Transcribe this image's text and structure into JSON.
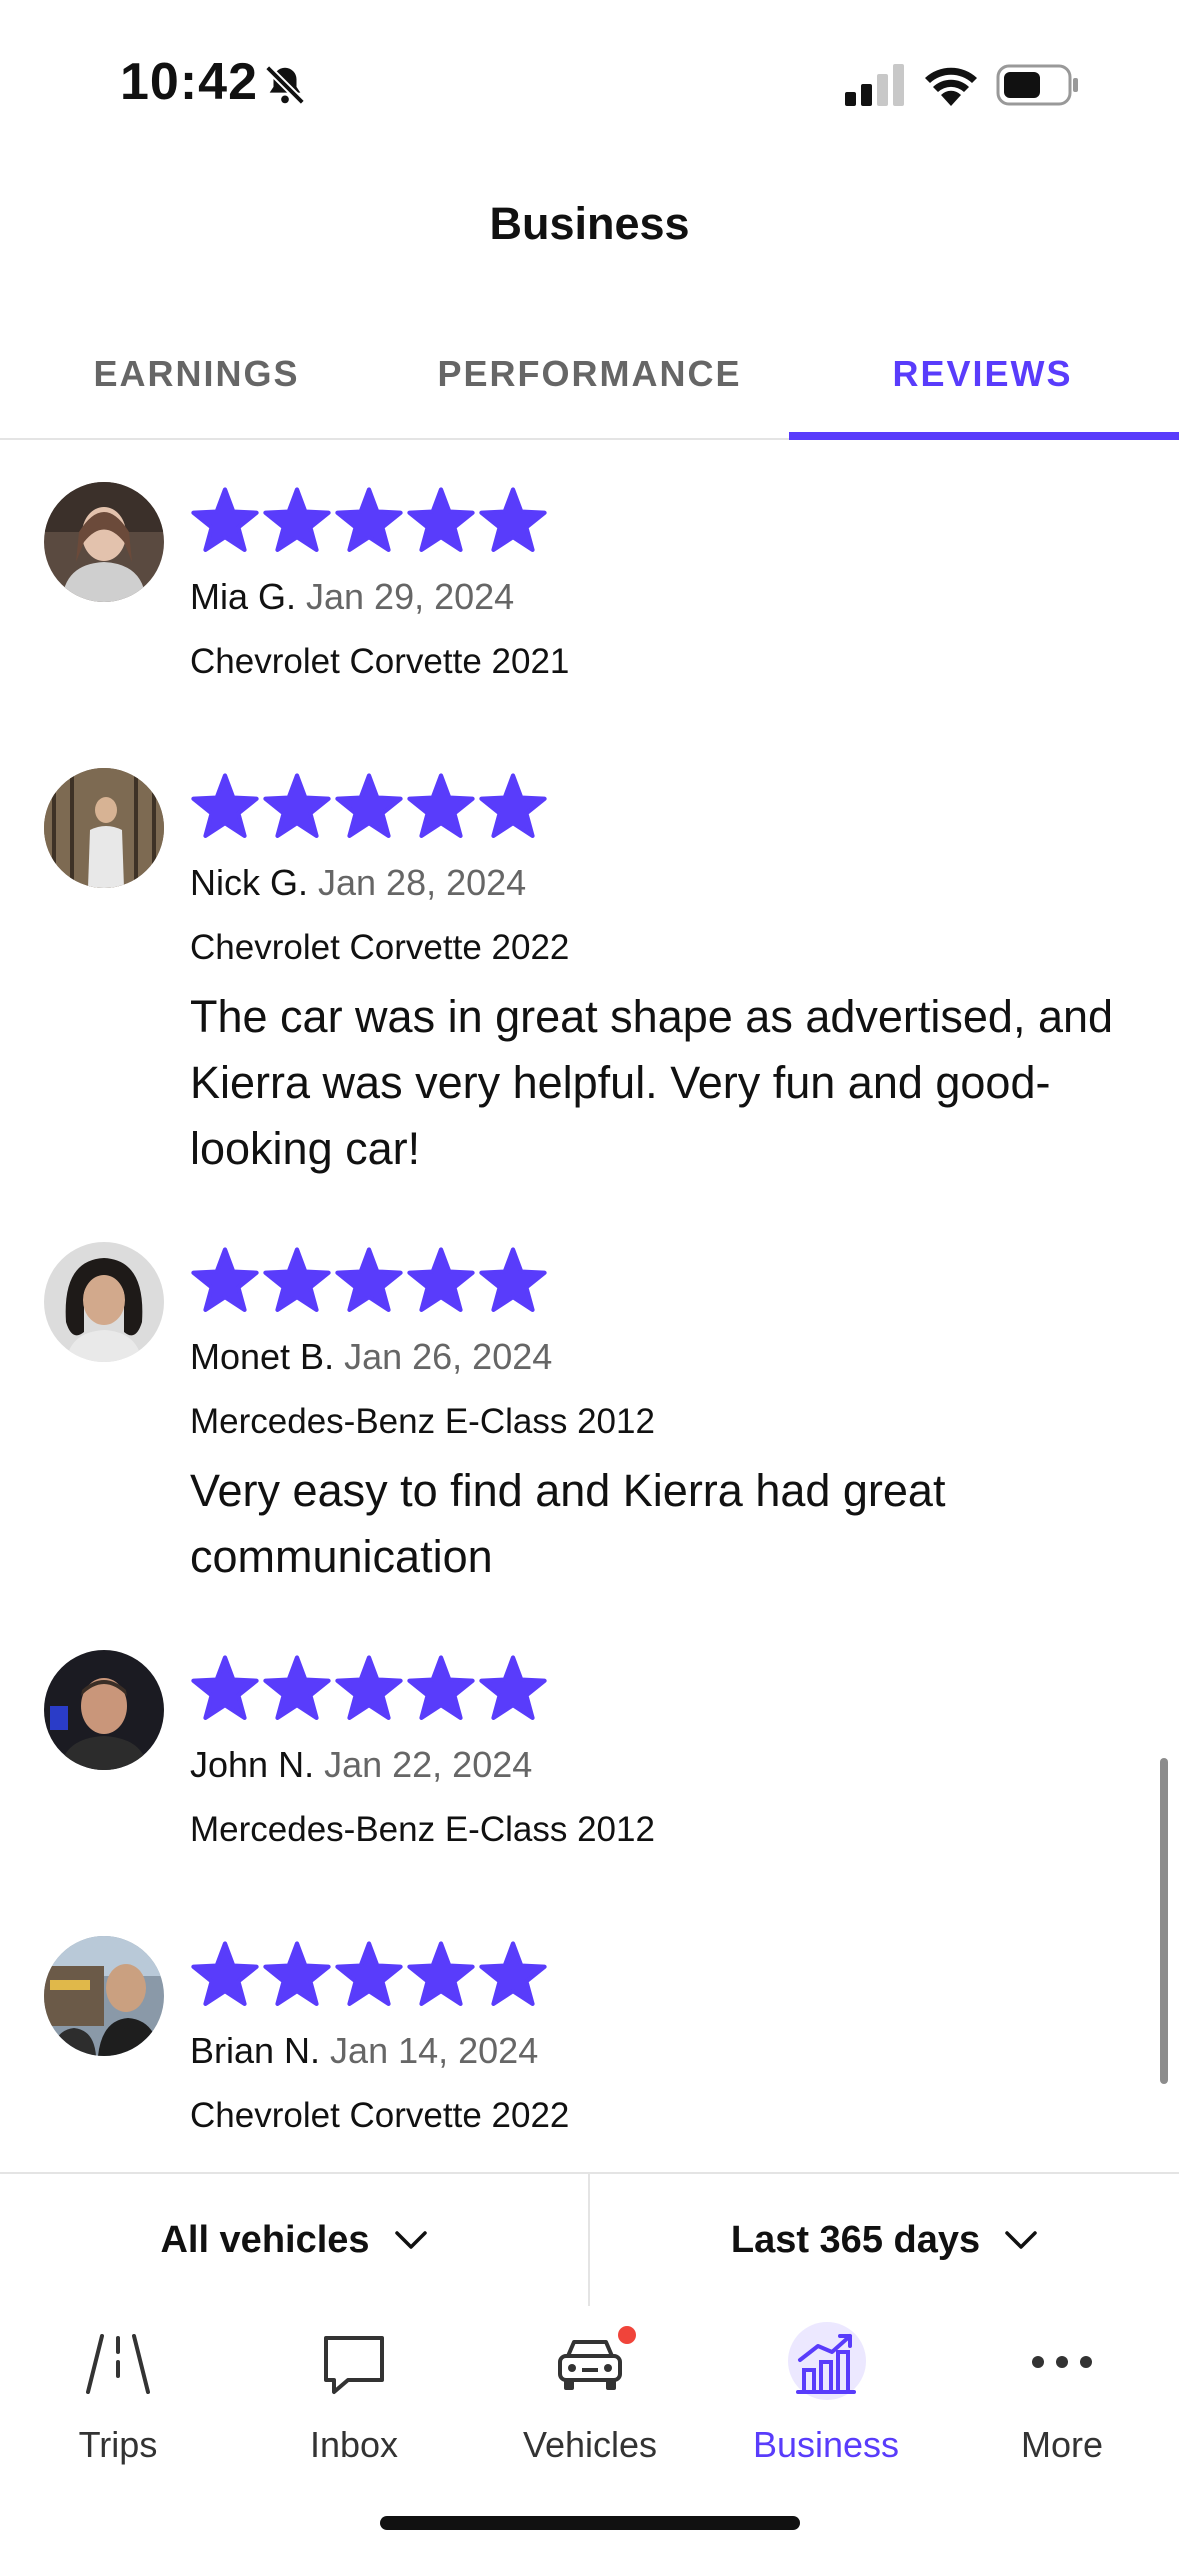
{
  "status_bar": {
    "time": "10:42"
  },
  "header": {
    "title": "Business"
  },
  "tabs": [
    {
      "label": "EARNINGS"
    },
    {
      "label": "PERFORMANCE"
    },
    {
      "label": "REVIEWS"
    }
  ],
  "active_tab": "REVIEWS",
  "reviews": [
    {
      "name": "Mia G.",
      "date": "Jan 29, 2024",
      "vehicle": "Chevrolet Corvette 2021",
      "rating": 5,
      "text": ""
    },
    {
      "name": "Nick G.",
      "date": "Jan 28, 2024",
      "vehicle": "Chevrolet Corvette 2022",
      "rating": 5,
      "text": "The car was in great shape as advertised, and Kierra was very helpful. Very fun and good-looking car!"
    },
    {
      "name": "Monet B.",
      "date": "Jan 26, 2024",
      "vehicle": "Mercedes-Benz E-Class 2012",
      "rating": 5,
      "text": "Very easy to find and Kierra had great communication"
    },
    {
      "name": "John N.",
      "date": "Jan 22, 2024",
      "vehicle": "Mercedes-Benz E-Class 2012",
      "rating": 5,
      "text": ""
    },
    {
      "name": "Brian N.",
      "date": "Jan 14, 2024",
      "vehicle": "Chevrolet Corvette 2022",
      "rating": 5,
      "text": ""
    }
  ],
  "filters": {
    "vehicles": "All vehicles",
    "period": "Last 365 days"
  },
  "nav": [
    {
      "label": "Trips",
      "icon": "road-icon"
    },
    {
      "label": "Inbox",
      "icon": "chat-bubble-icon"
    },
    {
      "label": "Vehicles",
      "icon": "car-icon"
    },
    {
      "label": "Business",
      "icon": "bar-chart-icon"
    },
    {
      "label": "More",
      "icon": "more-dots-icon"
    }
  ],
  "colors": {
    "accent": "#593CFB",
    "badge": "#F0443A"
  }
}
